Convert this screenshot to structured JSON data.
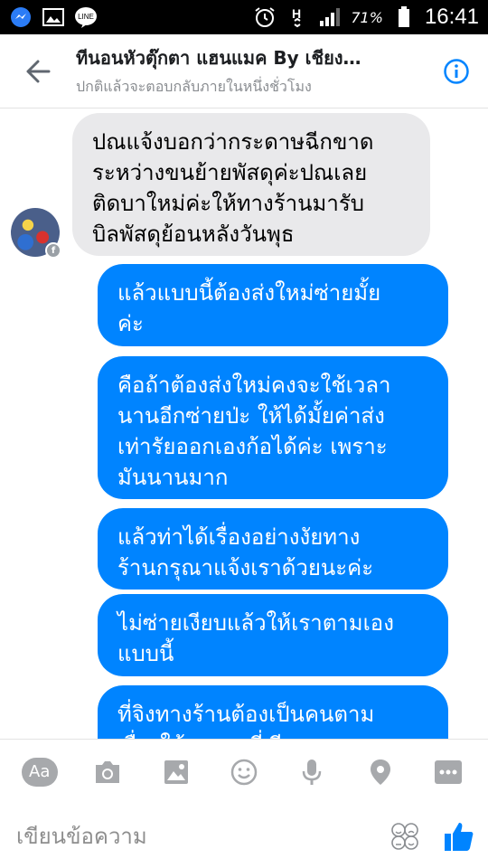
{
  "status_bar": {
    "battery_percent": "71%",
    "time": "16:41"
  },
  "header": {
    "title": "ทีนอนหัวตุ๊กตา แฮนแมค By เชียง…",
    "subtitle": "ปกติแล้วจะตอบกลับภายในหนึ่งชั่วโมง"
  },
  "messages": [
    {
      "direction": "incoming",
      "text": "ปณแจ้งบอกว่ากระดาษฉีกขาด\nระหว่างขนย้ายพัสดุค่ะปณเลย\nติดบาใหม่ค่ะให้ทางร้านมารับ\nบิลพัสดุย้อนหลังวันพุธ"
    },
    {
      "direction": "outgoing",
      "text": "แล้วแบบนี้ต้องส่งใหม่ซ่ายมั้ย\nค่ะ"
    },
    {
      "direction": "outgoing",
      "text": "คือถ้าต้องส่งใหม่คงจะใช้เวลา\nนานอีกซ่ายป่ะ ให้ได้มั้ยค่าส่ง\nเท่ารัยออกเองก้อได้ค่ะ เพราะ\nมันนานมาก"
    },
    {
      "direction": "outgoing",
      "text": "แล้วท่าได้เรื่องอย่างงัยทาง\nร้านกรุณาแจ้งเราด้วยนะค่ะ"
    },
    {
      "direction": "outgoing",
      "text": "ไม่ซ่ายเงียบแล้วให้เราตามเอง\nแบบนี้"
    },
    {
      "direction": "outgoing",
      "text": "ที่จิงทางร้านต้องเป็นคนตาม\nเรื่องให้เรามะ นี่เงียบมาตลอด"
    }
  ],
  "toolbar": {
    "aa_label": "Aa"
  },
  "composer": {
    "placeholder": "เขียนข้อความ"
  },
  "colors": {
    "outgoing_bubble": "#0084ff",
    "incoming_bubble": "#e9e9eb",
    "accent": "#0084ff"
  }
}
